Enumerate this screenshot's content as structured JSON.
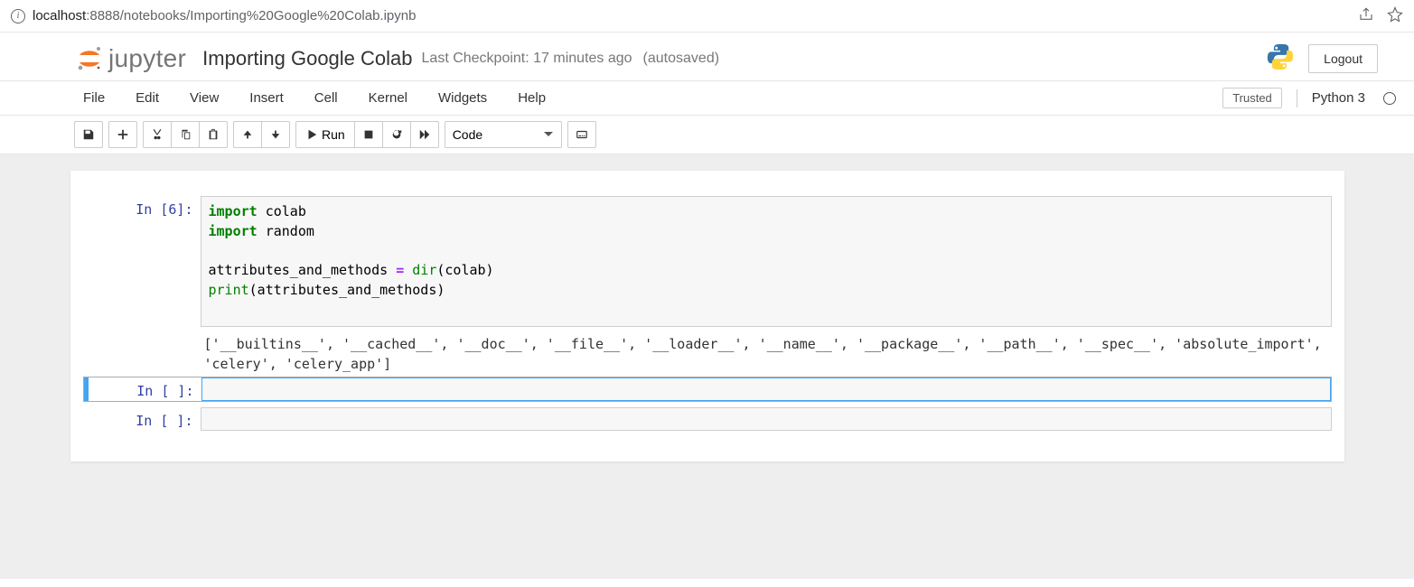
{
  "browser": {
    "url_host": "localhost",
    "url_port_path": ":8888/notebooks/Importing%20Google%20Colab.ipynb"
  },
  "header": {
    "logo_text": "jupyter",
    "notebook_title": "Importing Google Colab",
    "checkpoint_text": "Last Checkpoint: 17 minutes ago",
    "autosave_text": "(autosaved)",
    "logout_label": "Logout"
  },
  "menu": {
    "items": [
      "File",
      "Edit",
      "View",
      "Insert",
      "Cell",
      "Kernel",
      "Widgets",
      "Help"
    ],
    "trusted_label": "Trusted",
    "kernel_name": "Python 3"
  },
  "toolbar": {
    "run_label": "Run",
    "cell_type_selected": "Code"
  },
  "cells": [
    {
      "prompt": "In [6]:",
      "code_tokens": [
        {
          "t": "import ",
          "c": "cm-keyword"
        },
        {
          "t": "colab\n",
          "c": "cm-var"
        },
        {
          "t": "import ",
          "c": "cm-keyword"
        },
        {
          "t": "random\n",
          "c": "cm-var"
        },
        {
          "t": "\n",
          "c": ""
        },
        {
          "t": "attributes_and_methods ",
          "c": "cm-var"
        },
        {
          "t": "= ",
          "c": "cm-op"
        },
        {
          "t": "dir",
          "c": "cm-builtin"
        },
        {
          "t": "(colab)\n",
          "c": "cm-var"
        },
        {
          "t": "print",
          "c": "cm-builtin"
        },
        {
          "t": "(attributes_and_methods)\n",
          "c": "cm-var"
        },
        {
          "t": "\n",
          "c": ""
        }
      ],
      "output": "['__builtins__', '__cached__', '__doc__', '__file__', '__loader__', '__name__', '__package__', '__path__', '__spec__', 'absolute_import', 'celery', 'celery_app']"
    },
    {
      "prompt": "In [ ]:",
      "empty": true,
      "selected": true
    },
    {
      "prompt": "In [ ]:",
      "empty": true,
      "selected": false
    }
  ]
}
